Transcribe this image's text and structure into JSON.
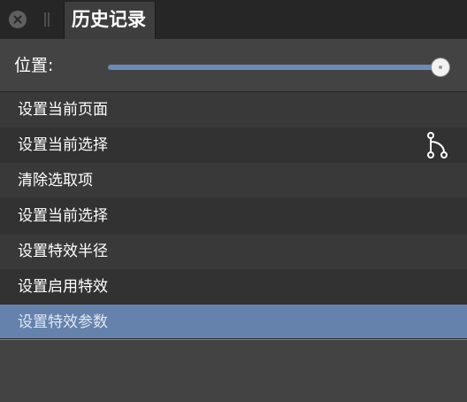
{
  "titlebar": {
    "tab_label": "历史记录"
  },
  "position": {
    "label": "位置:",
    "slider_value_fraction": 1.0
  },
  "history": {
    "items": [
      {
        "label": "设置当前页面"
      },
      {
        "label": "设置当前选择",
        "icon": "branch-icon"
      },
      {
        "label": "清除选取项"
      },
      {
        "label": "设置当前选择"
      },
      {
        "label": "设置特效半径"
      },
      {
        "label": "设置启用特效"
      },
      {
        "label": "设置特效参数",
        "selected": true
      }
    ]
  },
  "colors": {
    "titlebar_bg": "#262626",
    "panel_bg": "#434343",
    "selection": "#6582ad",
    "slider_fill": "#6b8bb8"
  }
}
